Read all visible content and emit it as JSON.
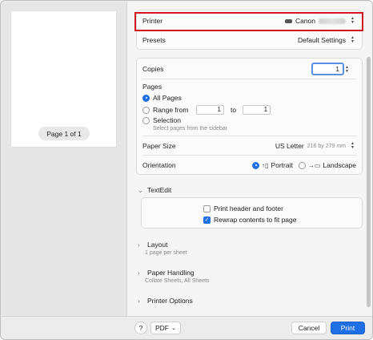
{
  "preview": {
    "page_indicator": "Page 1 of 1"
  },
  "printer": {
    "label": "Printer",
    "value": "Canon"
  },
  "presets": {
    "label": "Presets",
    "value": "Default Settings"
  },
  "copies": {
    "label": "Copies",
    "value": "1"
  },
  "pages": {
    "label": "Pages",
    "all_pages": "All Pages",
    "range_from": "Range from",
    "range_start": "1",
    "range_to": "to",
    "range_end": "1",
    "selection": "Selection",
    "selection_hint": "Select pages from the sidebar",
    "selected": "all"
  },
  "paper_size": {
    "label": "Paper Size",
    "value": "US Letter",
    "dimensions": "216 by 279 mm"
  },
  "orientation": {
    "label": "Orientation",
    "portrait": "Portrait",
    "landscape": "Landscape",
    "selected": "portrait"
  },
  "textedit": {
    "title": "TextEdit",
    "print_header_footer": "Print header and footer",
    "print_header_footer_checked": false,
    "rewrap": "Rewrap contents to fit page",
    "rewrap_checked": true
  },
  "sections": [
    {
      "title": "Layout",
      "subtitle": "1 page per sheet"
    },
    {
      "title": "Paper Handling",
      "subtitle": "Collate Sheets, All Sheets"
    },
    {
      "title": "Printer Options",
      "subtitle": ""
    }
  ],
  "footer": {
    "help": "?",
    "pdf": "PDF",
    "cancel": "Cancel",
    "print": "Print"
  },
  "colors": {
    "accent": "#1f6fe5",
    "highlight": "#d3191f"
  }
}
